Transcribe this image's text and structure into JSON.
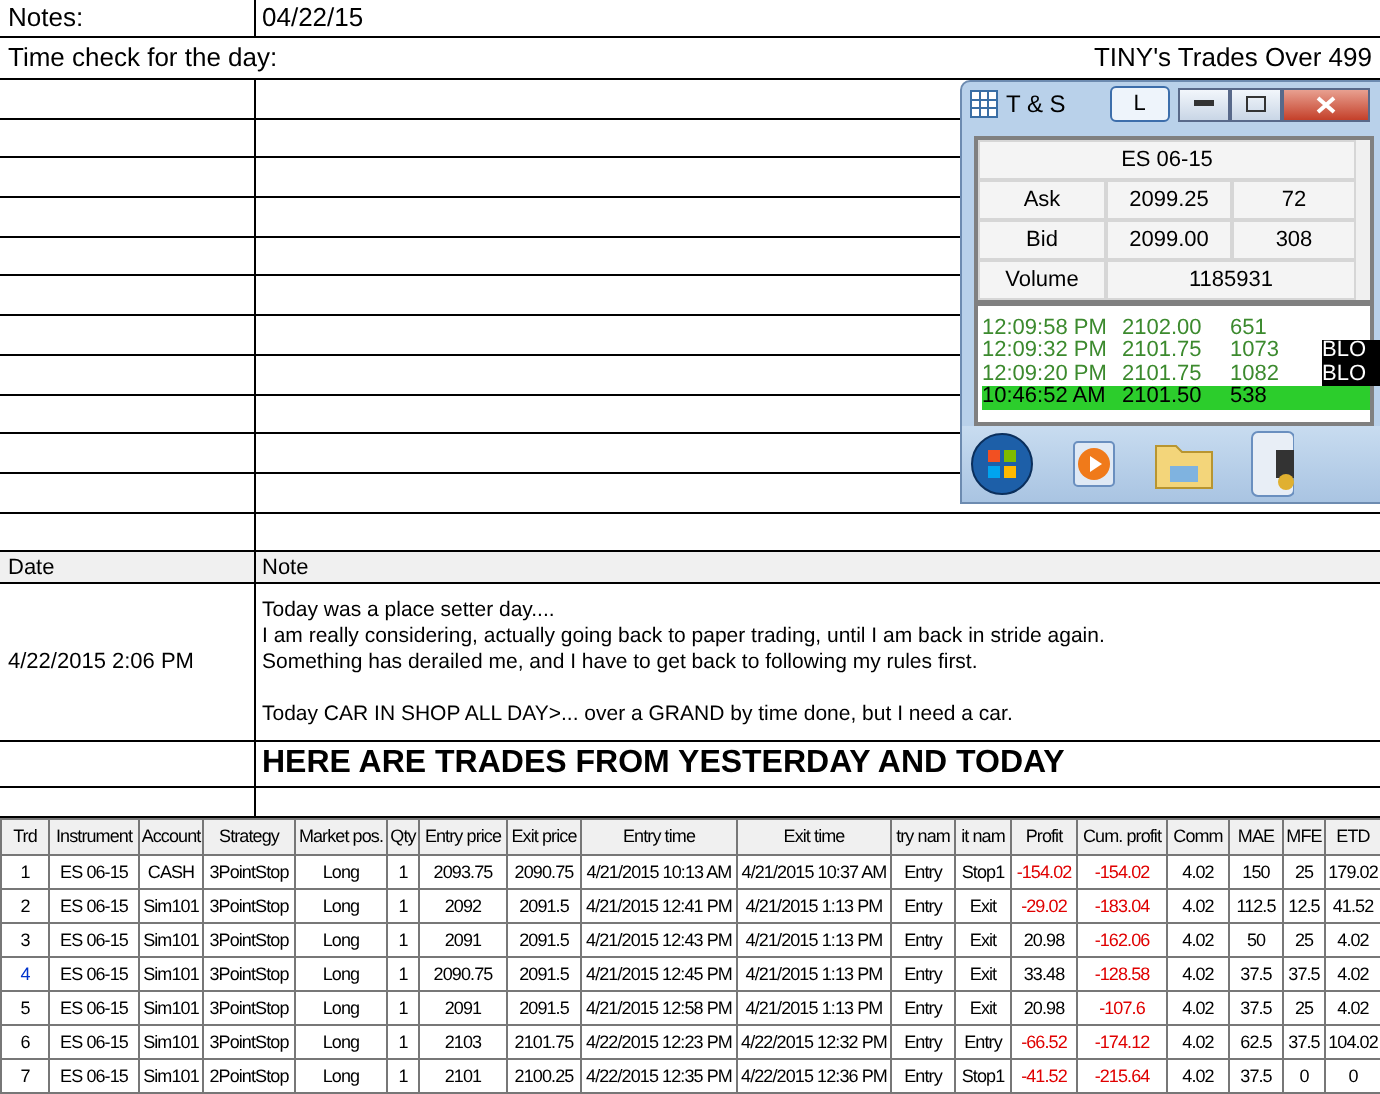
{
  "notes": {
    "label": "Notes:",
    "date": "04/22/15"
  },
  "time_check": {
    "label": "Time check for the day:",
    "title": "TINY's Trades Over 499"
  },
  "journal": {
    "columns": [
      "Date",
      "Note"
    ],
    "entry": {
      "date": "4/22/2015 2:06 PM",
      "paragraphs": [
        [
          "Today was a place setter day....",
          "I am really considering, actually going back to paper trading, until I am back in stride again.",
          "Something has derailed me, and I have to get back to following my rules first."
        ],
        [
          "Today CAR IN SHOP ALL DAY>... over a GRAND by time done, but I need a car."
        ]
      ]
    },
    "heading": "HERE ARE TRADES FROM YESTERDAY AND TODAY"
  },
  "ts_window": {
    "title": "T & S",
    "l_button": "L",
    "instrument": "ES 06-15",
    "quotes": [
      {
        "label": "Ask",
        "price": "2099.25",
        "size": "72"
      },
      {
        "label": "Bid",
        "price": "2099.00",
        "size": "308"
      }
    ],
    "volume": {
      "label": "Volume",
      "value": "1185931"
    },
    "tape": [
      {
        "time": "12:09:58 PM",
        "price": "2102.00",
        "size": "651",
        "highlighted": false
      },
      {
        "time": "12:09:32 PM",
        "price": "2101.75",
        "size": "1073",
        "tag": "BLO",
        "highlighted": false
      },
      {
        "time": "12:09:20 PM",
        "price": "2101.75",
        "size": "1082",
        "tag": "BLO",
        "highlighted": false
      },
      {
        "time": "10:46:52 AM",
        "price": "2101.50",
        "size": "538",
        "highlighted": true
      }
    ]
  },
  "trades": {
    "columns": [
      "Trd",
      "Instrument",
      "Account",
      "Strategy",
      "Market pos.",
      "Qty",
      "Entry price",
      "Exit price",
      "Entry time",
      "Exit time",
      "try nam",
      "it nam",
      "Profit",
      "Cum. profit",
      "Comm",
      "MAE",
      "MFE",
      "ETD"
    ],
    "rows": [
      {
        "selected": false,
        "cells": [
          "1",
          "ES 06-15",
          "CASH",
          "3PointStop",
          "Long",
          "1",
          "2093.75",
          "2090.75",
          "4/21/2015 10:13 AM",
          "4/21/2015 10:37 AM",
          "Entry",
          "Stop1",
          "-154.02",
          "-154.02",
          "4.02",
          "150",
          "25",
          "179.02"
        ],
        "profit_loss": true,
        "cum_loss": true
      },
      {
        "selected": false,
        "cells": [
          "2",
          "ES 06-15",
          "Sim101",
          "3PointStop",
          "Long",
          "1",
          "2092",
          "2091.5",
          "4/21/2015 12:41 PM",
          "4/21/2015 1:13 PM",
          "Entry",
          "Exit",
          "-29.02",
          "-183.04",
          "4.02",
          "112.5",
          "12.5",
          "41.52"
        ],
        "profit_loss": true,
        "cum_loss": true
      },
      {
        "selected": false,
        "cells": [
          "3",
          "ES 06-15",
          "Sim101",
          "3PointStop",
          "Long",
          "1",
          "2091",
          "2091.5",
          "4/21/2015 12:43 PM",
          "4/21/2015 1:13 PM",
          "Entry",
          "Exit",
          "20.98",
          "-162.06",
          "4.02",
          "50",
          "25",
          "4.02"
        ],
        "profit_loss": false,
        "cum_loss": true
      },
      {
        "selected": true,
        "cells": [
          "4",
          "ES 06-15",
          "Sim101",
          "3PointStop",
          "Long",
          "1",
          "2090.75",
          "2091.5",
          "4/21/2015 12:45 PM",
          "4/21/2015 1:13 PM",
          "Entry",
          "Exit",
          "33.48",
          "-128.58",
          "4.02",
          "37.5",
          "37.5",
          "4.02"
        ],
        "profit_loss": false,
        "cum_loss": true
      },
      {
        "selected": false,
        "cells": [
          "5",
          "ES 06-15",
          "Sim101",
          "3PointStop",
          "Long",
          "1",
          "2091",
          "2091.5",
          "4/21/2015 12:58 PM",
          "4/21/2015 1:13 PM",
          "Entry",
          "Exit",
          "20.98",
          "-107.6",
          "4.02",
          "37.5",
          "25",
          "4.02"
        ],
        "profit_loss": false,
        "cum_loss": true
      },
      {
        "selected": false,
        "cells": [
          "6",
          "ES 06-15",
          "Sim101",
          "3PointStop",
          "Long",
          "1",
          "2103",
          "2101.75",
          "4/22/2015 12:23 PM",
          "4/22/2015 12:32 PM",
          "Entry",
          "Entry",
          "-66.52",
          "-174.12",
          "4.02",
          "62.5",
          "37.5",
          "104.02"
        ],
        "profit_loss": true,
        "cum_loss": true
      },
      {
        "selected": false,
        "cells": [
          "7",
          "ES 06-15",
          "Sim101",
          "2PointStop",
          "Long",
          "1",
          "2101",
          "2100.25",
          "4/22/2015 12:35 PM",
          "4/22/2015 12:36 PM",
          "Entry",
          "Stop1",
          "-41.52",
          "-215.64",
          "4.02",
          "37.5",
          "0",
          "0"
        ],
        "profit_loss": true,
        "cum_loss": true
      }
    ]
  }
}
